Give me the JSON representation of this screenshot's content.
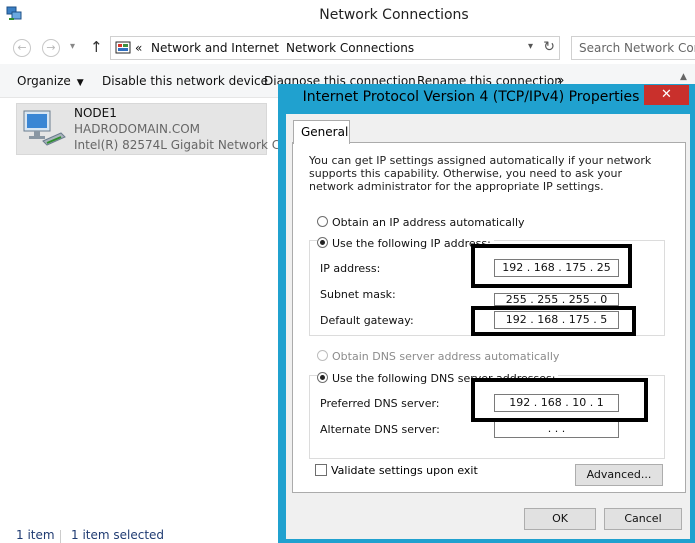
{
  "window": {
    "title": "Network Connections"
  },
  "address_bar": {
    "prefix": "«",
    "crumbs": [
      "Network and Internet",
      "Network Connections"
    ],
    "search_placeholder": "Search Network Conne"
  },
  "command_bar": {
    "organize": "Organize",
    "disable": "Disable this network device",
    "diagnose": "Diagnose this connection",
    "rename": "Rename this connection",
    "more": "»"
  },
  "connection_item": {
    "name": "NODE1",
    "domain": "HADRODOMAIN.COM",
    "adapter": "Intel(R) 82574L Gigabit Network C..."
  },
  "status_bar": {
    "count": "1 item",
    "selected": "1 item selected"
  },
  "dialog": {
    "title": "Internet Protocol Version 4 (TCP/IPv4) Properties",
    "close": "✕",
    "tab": "General",
    "description": "You can get IP settings assigned automatically if your network supports this capability. Otherwise, you need to ask your network administrator for the appropriate IP settings.",
    "ip_auto": "Obtain an IP address automatically",
    "ip_manual": "Use the following IP address:",
    "ip_label": "IP address:",
    "ip_value": "192 . 168 . 175 . 25",
    "mask_label": "Subnet mask:",
    "mask_value": "255 . 255 . 255 . 0",
    "gateway_label": "Default gateway:",
    "gateway_value": "192 . 168 . 175 . 5",
    "dns_auto": "Obtain DNS server address automatically",
    "dns_manual": "Use the following DNS server addresses:",
    "preferred_label": "Preferred DNS server:",
    "preferred_value": "192 . 168 . 10 . 1",
    "alternate_label": "Alternate DNS server:",
    "alternate_value": ".       .       .",
    "validate": "Validate settings upon exit",
    "advanced": "Advanced...",
    "ok": "OK",
    "cancel": "Cancel"
  },
  "colors": {
    "dialog_frame": "#20a1cf",
    "close_button": "#c9302c",
    "highlight_box": "#000000"
  }
}
